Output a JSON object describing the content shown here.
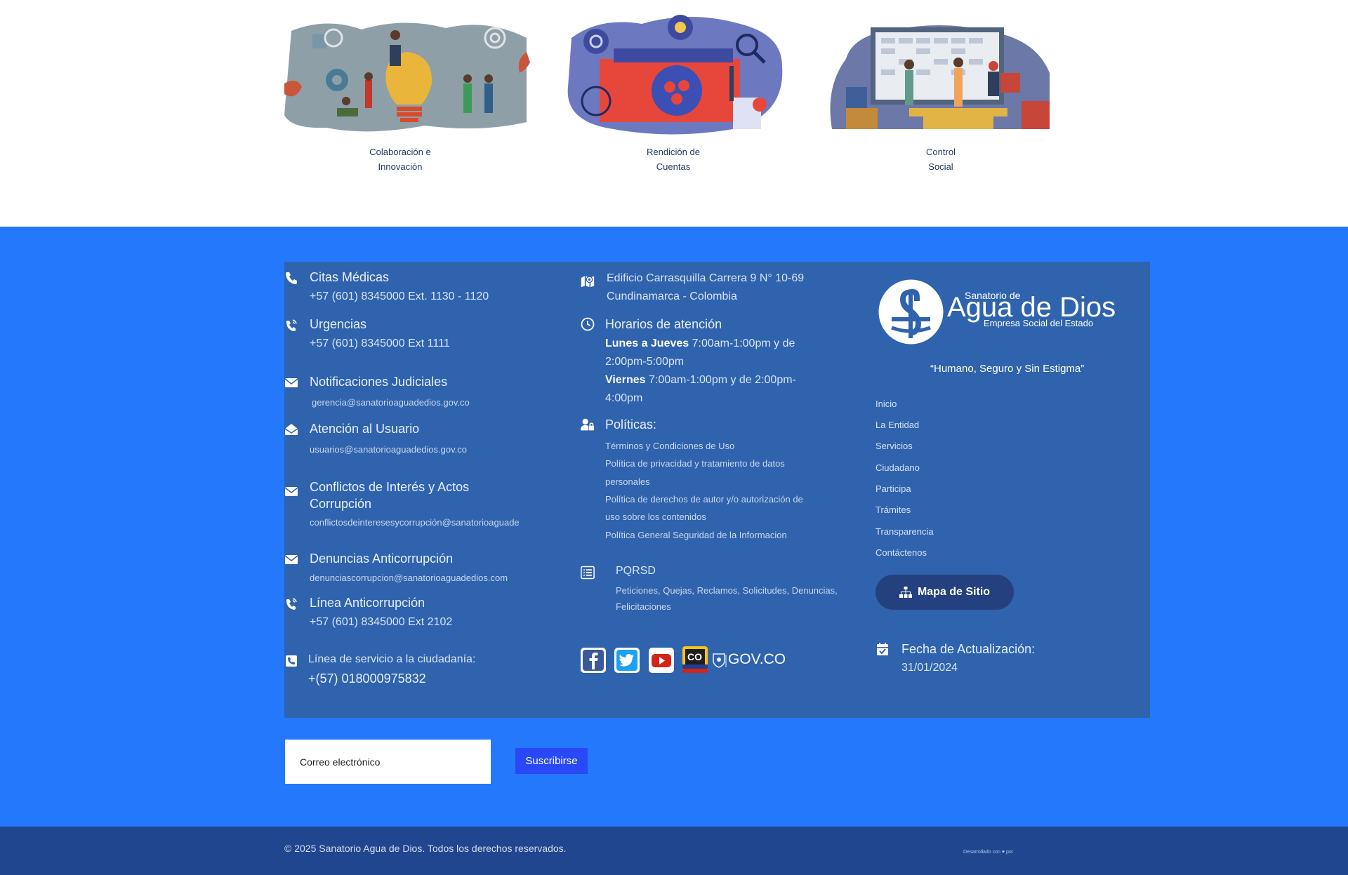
{
  "cards": [
    {
      "line1": "Colaboración e",
      "line2": "Innovación"
    },
    {
      "line1": "Rendición de",
      "line2": "Cuentas"
    },
    {
      "line1": "Control",
      "line2": "Social"
    }
  ],
  "contact": {
    "citas_title": "Citas Médicas",
    "citas_phone": "+57 (601) 8345000 Ext. 1130 - 1120",
    "urgencias_title": "Urgencias",
    "urgencias_phone": "+57 (601) 8345000 Ext 1111",
    "notif_title": "Notificaciones Judiciales",
    "notif_email": "gerencia@sanatorioaguadedios.gov.co",
    "atencion_title": "Atención al Usuario",
    "atencion_email": "usuarios@sanatorioaguadedios.gov.co",
    "conflictos_title_1": "Conflictos de Interés y Actos",
    "conflictos_title_2": "Corrupción",
    "conflictos_email": "conflictosdeinteresesycorrupción@sanatorioaguade",
    "denuncias_title": "Denuncias Anticorrupción",
    "denuncias_email": "denunciascorrupcion@sanatorioaguadedios.com",
    "linea_title": "Línea Anticorrupción",
    "linea_phone": "+57 (601) 8345000 Ext 2102",
    "servicio_title": "Línea de servicio a la ciudadanía:",
    "servicio_phone": "+(57) 018000975832"
  },
  "address": {
    "line1": "Edificio Carrasquilla Carrera 9 N° 10-69",
    "line2": "Cundinamarca - Colombia"
  },
  "hours": {
    "title": "Horarios de atención",
    "mon_thu_label": "Lunes a Jueves",
    "mon_thu_value_1": " 7:00am-1:00pm y de",
    "mon_thu_value_2": "2:00pm-5:00pm",
    "fri_label": "Viernes",
    "fri_value_1": " 7:00am-1:00pm y de 2:00pm-",
    "fri_value_2": "4:00pm"
  },
  "policies": {
    "title": "Políticas:",
    "items": [
      "Términos y Condiciones de Uso",
      "Política de privacidad y tratamiento de datos",
      "personales",
      "Política de derechos de autor y/o autorización de",
      "uso sobre los contenidos",
      "Política General Seguridad de la Informacion"
    ]
  },
  "pqrsd": {
    "title": "PQRSD",
    "desc_1": "Peticiones, Quejas, Reclamos, Solicitudes, Denuncias,",
    "desc_2": "Felicitaciones"
  },
  "social": {
    "gov_label": "GOV.CO",
    "co_label": "CO"
  },
  "brand": {
    "top": "Sanatorio de",
    "name": "Agua de Dios",
    "sub": "Empresa Social del Estado",
    "slogan": "“Humano, Seguro y Sin Estigma”"
  },
  "nav": [
    "Inicio",
    "La Entidad",
    "Servicios",
    "Ciudadano",
    "Participa",
    "Trámites",
    "Transparencia",
    "Contáctenos"
  ],
  "mapa_label": "Mapa de Sitio",
  "update": {
    "title": "Fecha de Actualización:",
    "date": "31/01/2024"
  },
  "newsletter": {
    "placeholder": "Correo electrónico",
    "button": "Suscribirse"
  },
  "bottom": {
    "copyright": "© 2025 Sanatorio Agua de Dios. Todos los derechos reservados.",
    "dev": "Desarrollado con ♥ por"
  },
  "colors": {
    "footer_bg": "#2478fb",
    "panel_bg": "#2f63ad",
    "bottom_bg": "#214690",
    "button_dark": "#25407f",
    "subscribe": "#2849f5"
  }
}
